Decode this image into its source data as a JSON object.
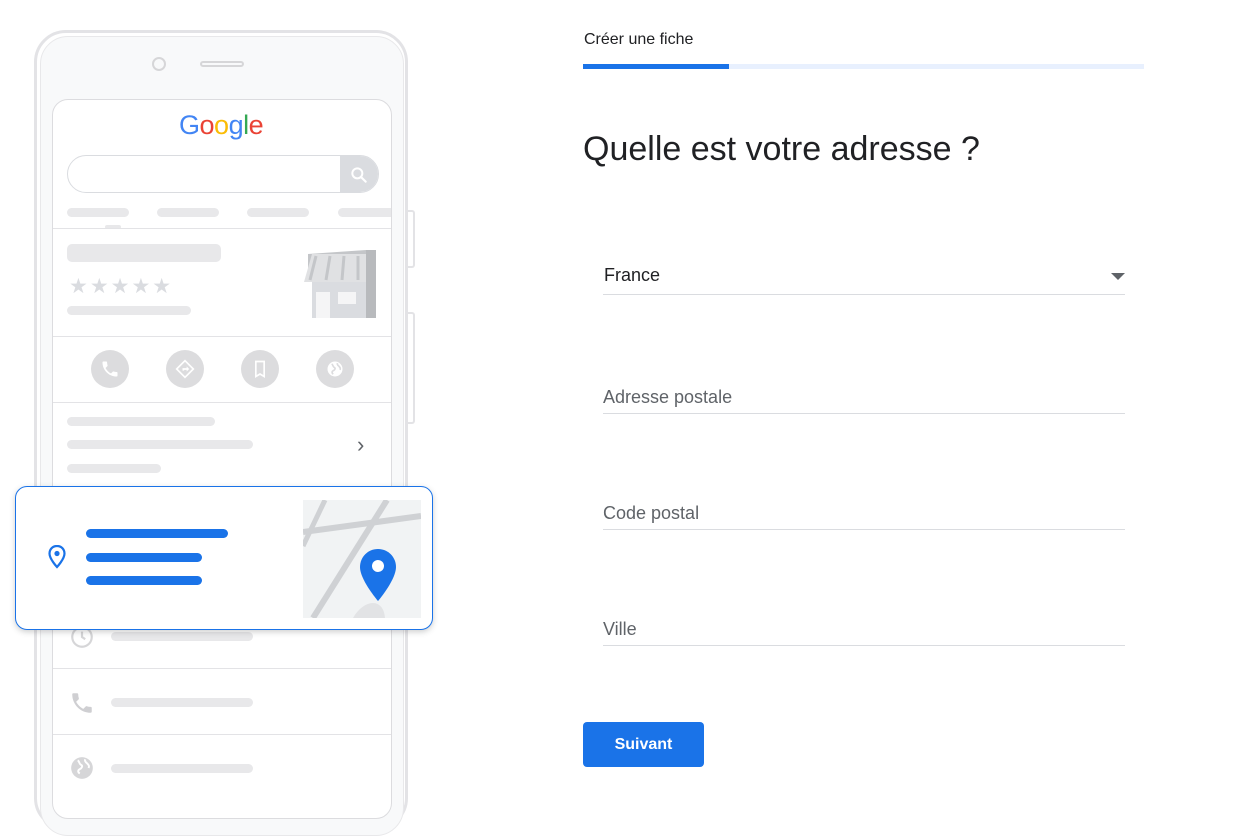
{
  "illustration": {
    "logo_letters": [
      {
        "char": "G",
        "color": "#4285F4"
      },
      {
        "char": "o",
        "color": "#EA4335"
      },
      {
        "char": "o",
        "color": "#FBBC05"
      },
      {
        "char": "g",
        "color": "#4285F4"
      },
      {
        "char": "l",
        "color": "#34A853"
      },
      {
        "char": "e",
        "color": "#EA4335"
      }
    ],
    "rating_stars": "★★★★★",
    "action_icons": [
      "phone-icon",
      "directions-icon",
      "bookmark-icon",
      "website-icon"
    ]
  },
  "form": {
    "step_title": "Créer une fiche",
    "progress": 0.26,
    "heading": "Quelle est votre adresse ?",
    "country": {
      "value": "France"
    },
    "street": {
      "placeholder": "Adresse postale",
      "value": ""
    },
    "postal_code": {
      "placeholder": "Code postal",
      "value": ""
    },
    "city": {
      "placeholder": "Ville",
      "value": ""
    },
    "next_label": "Suivant"
  },
  "colors": {
    "accent": "#1a73e8",
    "track": "#e8f0fe"
  }
}
